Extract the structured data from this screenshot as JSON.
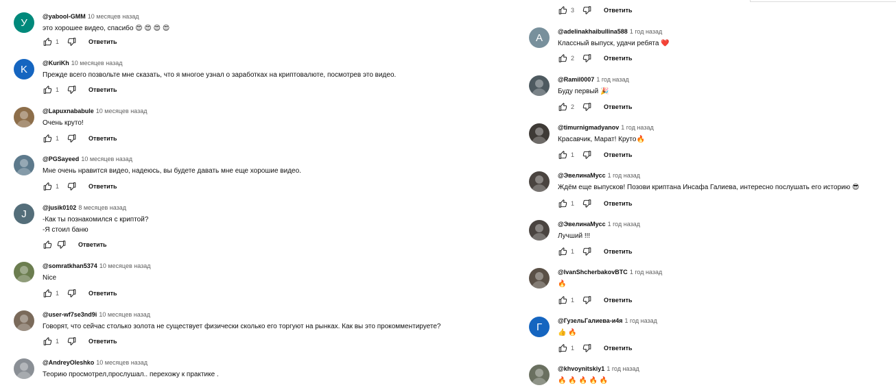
{
  "reply_label": "Ответить",
  "colors": {
    "avatar_teal": "#00897b",
    "avatar_blue": "#1565c0",
    "avatar_gray": "#546e7a",
    "heart": "#e53935",
    "fire": "#ff7043"
  },
  "left_comments": [
    {
      "author": "@yabool-GMM",
      "time": "10 месяцев назад",
      "lines": [
        "это хорошее видео, спасибо 😍 😍 😍 😍"
      ],
      "likes": "1",
      "avatar_letter": "У",
      "avatar_color": "#00897b"
    },
    {
      "author": "@KuriKh",
      "time": "10 месяцев назад",
      "lines": [
        "Прежде всего позвольте мне сказать, что я многое узнал о заработках на криптовалюте, посмотрев это видео."
      ],
      "likes": "1",
      "avatar_letter": "K",
      "avatar_color": "#1565c0"
    },
    {
      "author": "@Lapuxnababule",
      "time": "10 месяцев назад",
      "lines": [
        "Очень круто!"
      ],
      "likes": "1",
      "avatar_letter": "",
      "avatar_color": "#8d6e4a"
    },
    {
      "author": "@PGSayeed",
      "time": "10 месяцев назад",
      "lines": [
        "Мне очень нравится видео, надеюсь, вы будете давать мне еще хорошие видео."
      ],
      "likes": "1",
      "avatar_letter": "",
      "avatar_color": "#5d7a8c"
    },
    {
      "author": "@jusik0102",
      "time": "8 месяцев назад",
      "lines": [
        "-Как ты познакомился с криптой?",
        "-Я стоил баню"
      ],
      "likes": "",
      "avatar_letter": "J",
      "avatar_color": "#546e7a"
    },
    {
      "author": "@somratkhan5374",
      "time": "10 месяцев назад",
      "lines": [
        "Nice"
      ],
      "likes": "1",
      "avatar_letter": "",
      "avatar_color": "#6b7d4f"
    },
    {
      "author": "@user-wf7se3nd9i",
      "time": "10 месяцев назад",
      "lines": [
        "Говорят, что сейчас столько золота не существует физически сколько его торгуют на рынках. Как вы это прокомментируете?"
      ],
      "likes": "1",
      "avatar_letter": "",
      "avatar_color": "#7a6a5a"
    },
    {
      "author": "@AndreyOleshko",
      "time": "10 месяцев назад",
      "lines": [
        "Теорию просмотрел,прослушал.. перехожу к практике ."
      ],
      "likes": "",
      "avatar_letter": "",
      "avatar_color": "#8a8f95"
    }
  ],
  "right_top_likes": "3",
  "right_comments": [
    {
      "author": "@adelinakhaibullina588",
      "time": "1 год назад",
      "lines": [
        "Классный выпуск, удачи ребята ❤️"
      ],
      "likes": "2",
      "avatar_letter": "A",
      "avatar_color": "#78909c"
    },
    {
      "author": "@Ramil0007",
      "time": "1 год назад",
      "lines": [
        "Буду первый 🎉"
      ],
      "likes": "2",
      "avatar_letter": "",
      "avatar_color": "#4e5a60"
    },
    {
      "author": "@timurnigmadyanov",
      "time": "1 год назад",
      "lines": [
        "Красавчик, Марат! Круто🔥"
      ],
      "likes": "1",
      "avatar_letter": "",
      "avatar_color": "#3e3a36"
    },
    {
      "author": "@ЭвелинаМусс",
      "time": "1 год назад",
      "lines": [
        "Ждём еще выпусков! Позови криптана Инсафа Галиева, интересно послушать его историю 😎"
      ],
      "likes": "1",
      "avatar_letter": "",
      "avatar_color": "#4a4440"
    },
    {
      "author": "@ЭвелинаМусс",
      "time": "1 год назад",
      "lines": [
        "Лучший !!!"
      ],
      "likes": "1",
      "avatar_letter": "",
      "avatar_color": "#4a4440"
    },
    {
      "author": "@IvanShcherbakovBTC",
      "time": "1 год назад",
      "lines": [
        "🔥"
      ],
      "likes": "1",
      "avatar_letter": "",
      "avatar_color": "#5a5046"
    },
    {
      "author": "@ГузельГалиева-и4я",
      "time": "1 год назад",
      "lines": [
        "👍 🔥"
      ],
      "likes": "1",
      "avatar_letter": "Г",
      "avatar_color": "#1565c0"
    },
    {
      "author": "@khvoynitskiy1",
      "time": "1 год назад",
      "lines": [
        "🔥 🔥 🔥 🔥 🔥"
      ],
      "likes": "",
      "avatar_letter": "",
      "avatar_color": "#6a7060"
    }
  ]
}
